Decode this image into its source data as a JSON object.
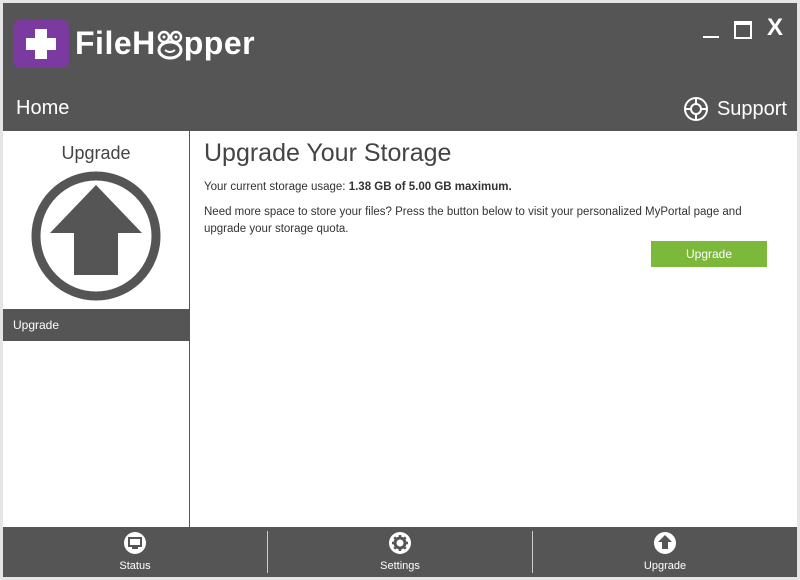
{
  "app": {
    "brand_prefix": "FileH",
    "brand_suffix": "pper",
    "window_controls": {
      "minimize_icon": "minimize-icon",
      "maximize_icon": "maximize-icon",
      "close_label": "X"
    }
  },
  "nav": {
    "home_label": "Home",
    "support_label": "Support",
    "support_icon": "support-lifebuoy-icon"
  },
  "sidebar": {
    "title": "Upgrade",
    "icon": "upgrade-arrow-icon",
    "items": [
      {
        "label": "Upgrade",
        "selected": true
      }
    ]
  },
  "main": {
    "title": "Upgrade Your Storage",
    "usage_prefix": "Your current storage usage: ",
    "usage_value": "1.38 GB of 5.00 GB maximum.",
    "description": "Need more space to store your files? Press the button below to visit your personalized MyPortal page and upgrade your storage quota.",
    "upgrade_button_label": "Upgrade"
  },
  "bottom_bar": {
    "items": [
      {
        "label": "Status",
        "icon": "status-monitor-icon"
      },
      {
        "label": "Settings",
        "icon": "settings-gear-icon"
      },
      {
        "label": "Upgrade",
        "icon": "upgrade-arrow-icon"
      }
    ]
  },
  "colors": {
    "chrome": "#555555",
    "logo_purple": "#7a3aa0",
    "accent_green": "#7cb83a",
    "background": "#ffffff"
  }
}
